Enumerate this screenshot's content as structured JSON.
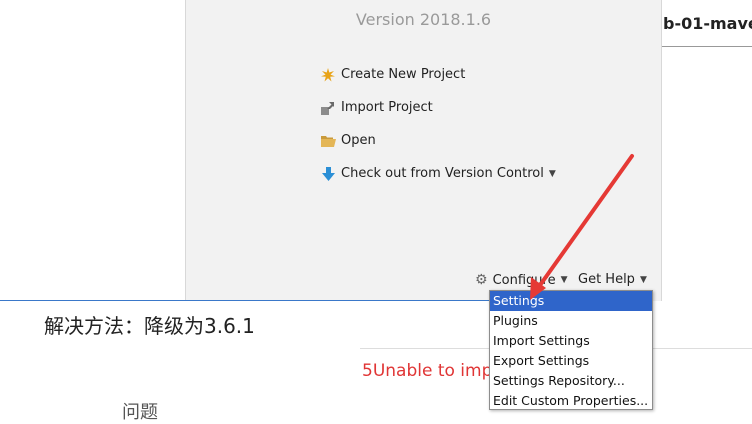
{
  "welcome": {
    "version": "Version 2018.1.6",
    "actions": [
      {
        "label": "Create New Project",
        "icon": "new-project-icon"
      },
      {
        "label": "Import Project",
        "icon": "import-project-icon"
      },
      {
        "label": "Open",
        "icon": "folder-open-icon"
      },
      {
        "label": "Check out from Version Control",
        "icon": "download-arrow-icon"
      }
    ],
    "bottom": {
      "configure_label": "Configure",
      "get_help_label": "Get Help"
    }
  },
  "background": {
    "tab_fragment": "b-01-mave",
    "chinese_text": "解决方法：降级为3.6.1",
    "chinese_text2": "问题",
    "error_text": "5Unable to impo                See logs for"
  },
  "configure_menu": {
    "items": [
      {
        "label": "Settings",
        "selected": true
      },
      {
        "label": "Plugins"
      },
      {
        "label": "Import Settings"
      },
      {
        "label": "Export Settings"
      },
      {
        "label": "Settings Repository..."
      },
      {
        "label": "Edit Custom Properties..."
      }
    ]
  },
  "colors": {
    "menu_selected": "#2f65ca",
    "error_red": "#e03535",
    "annotation_arrow": "#e53935"
  }
}
